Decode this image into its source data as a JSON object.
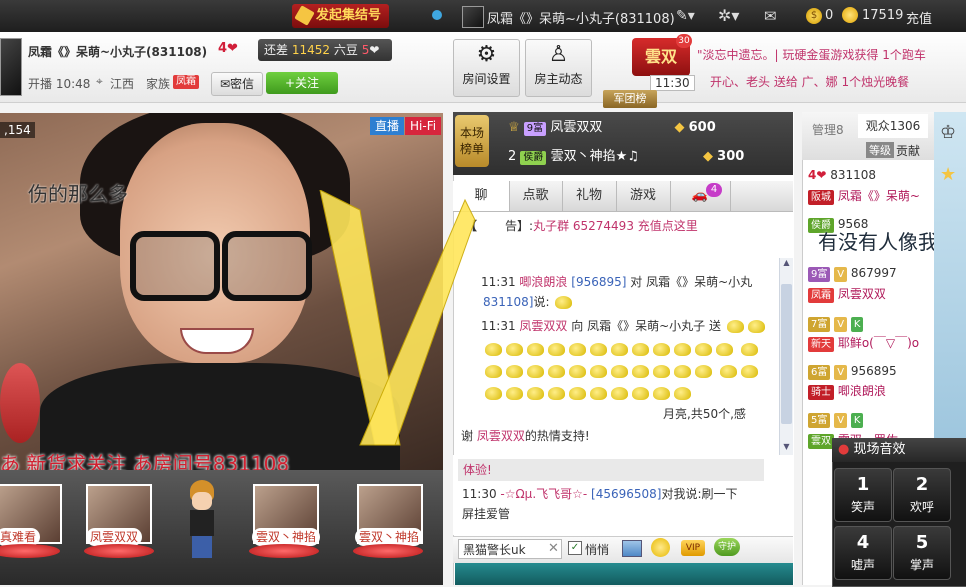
{
  "topbar": {
    "rally_label": "发起集结号",
    "user_name": "凤霜《》呆萌~小丸子(831108)",
    "coins": "0",
    "beans": "17519",
    "recharge": "充值"
  },
  "host": {
    "name": "凤霜《》呆萌~小丸子(831108)",
    "level": "4",
    "still_need": "还差",
    "still_num": "11452",
    "still_unit": "六豆",
    "next_level": "5",
    "live_time": "开播 10:48",
    "location": "江西",
    "family_label": "家族",
    "family_tag": "凤霜",
    "message": "密信",
    "follow": "+关注"
  },
  "buttons": {
    "room_settings": "房间设置",
    "host_news": "房主动态"
  },
  "banner": {
    "badge": "雲双",
    "badge_level": "30",
    "time": "11:30",
    "line1": "\"淡忘中遗忘。| 玩硬金蛋游戏获得 1个跑车",
    "line2": "开心、老头 送给 广、娜 1个烛光晚餐",
    "army_rank": "军团榜"
  },
  "video": {
    "live_tag": "直播",
    "hifi_tag": "Hi-Fi",
    "viewer_count": "154",
    "caption_top": "伤的那么多",
    "caption_bottom": "あ 新货求关注 あ房间号831108"
  },
  "guests": [
    {
      "label": "真难看"
    },
    {
      "label": "凤雲双双"
    },
    {
      "label": "雲双丶神掐"
    },
    {
      "label": "雲双丶神掐"
    }
  ],
  "ranking": {
    "badge": "本场榜单",
    "rows": [
      {
        "rank": "",
        "level": "9富",
        "name": "凤雲双双",
        "value": "600"
      },
      {
        "rank": "2",
        "level": "侯爵",
        "name": "雲双丶神掐★♫",
        "value": "300"
      }
    ]
  },
  "tabs": {
    "items": [
      "聊",
      "点歌",
      "礼物",
      "游戏",
      "🚗"
    ],
    "badge": "4"
  },
  "chat": {
    "announce_prefix": "【",
    "announce_label": "告】:",
    "announce": "丸子群 65274493 充值点这里",
    "line1_time": "11:31",
    "line1_user": "唧浪朗浪",
    "line1_id": "[956895]",
    "line1_to": "对 凤霜《》呆萌~小丸",
    "line1_id2": "831108]",
    "line1_said": "说:",
    "line2_time": "11:31",
    "line2_user": "凤雲双双",
    "line2_to": "向 凤霜《》呆萌~小丸子 送",
    "gift_tail": "月亮,共50个,感",
    "thanks": "谢",
    "thanks_user": "凤雲双双",
    "thanks_tail": "的热情支持!"
  },
  "chat2": {
    "trial": "体验!",
    "time": "11:30",
    "user": "-☆Ωμ.飞飞哥☆-",
    "uid": "[45696508]",
    "says": "对我说:刷一下",
    "line2": "屏挂爱管"
  },
  "input": {
    "target": "黑猫警长uk",
    "quiet": "悄悄"
  },
  "rlist": {
    "admin_tab": "管理8",
    "viewer_tab": "观众1306",
    "level_tab": "等级",
    "contrib_tab": "贡献",
    "items": [
      {
        "tag": "4",
        "text": "831108"
      },
      {
        "tag": "阪城",
        "text": "凤霜《》呆萌~"
      },
      {
        "tag": "侯爵",
        "text": "9568"
      },
      {
        "tag": "9富",
        "text": "867997"
      },
      {
        "tag": "凤霜",
        "text": "凤雲双双"
      },
      {
        "tag": "7富",
        "text": ""
      },
      {
        "tag": "新天",
        "text": "耶鲜o(￣▽￣)o"
      },
      {
        "tag": "6富",
        "text": "956895"
      },
      {
        "tag": "骑士",
        "text": "唧浪朗浪"
      },
      {
        "tag": "5富",
        "text": ""
      },
      {
        "tag": "雲双",
        "text": "雲双。罗佐"
      }
    ],
    "overlay": "有没有人像我"
  },
  "sound": {
    "title": "现场音效",
    "buttons": [
      {
        "num": "1",
        "label": "笑声"
      },
      {
        "num": "2",
        "label": "欢呼"
      },
      {
        "num": "4",
        "label": "嘘声"
      },
      {
        "num": "5",
        "label": "掌声"
      }
    ]
  }
}
